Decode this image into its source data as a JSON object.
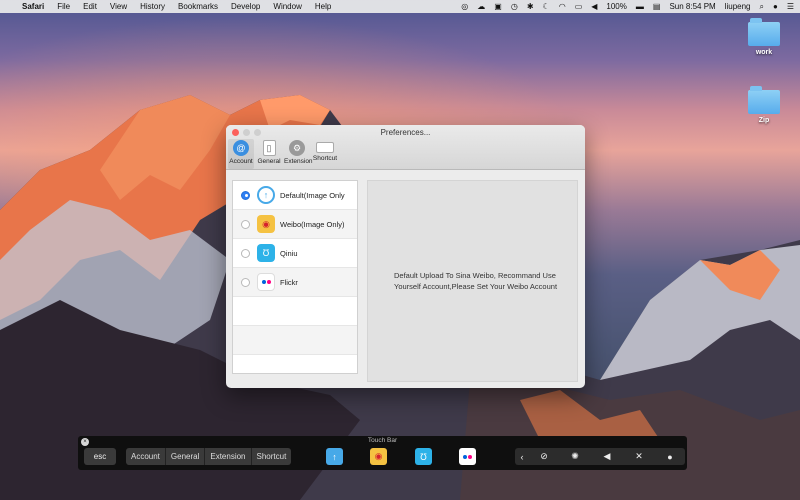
{
  "menubar": {
    "apple": "",
    "app": "Safari",
    "items": [
      "File",
      "Edit",
      "View",
      "History",
      "Bookmarks",
      "Develop",
      "Window",
      "Help"
    ],
    "battery": "100%",
    "clock": "Sun 8:54 PM",
    "user": "liupeng"
  },
  "desktop": {
    "icons": [
      {
        "label": "work"
      },
      {
        "label": "Zip"
      }
    ]
  },
  "window": {
    "title": "Preferences...",
    "tabs": [
      {
        "label": "Account",
        "icon": "at-icon",
        "active": true
      },
      {
        "label": "General",
        "icon": "phone-icon"
      },
      {
        "label": "Extension",
        "icon": "gear-icon"
      },
      {
        "label": "Shortcut",
        "icon": "keyboard-icon"
      }
    ],
    "services": [
      {
        "label": "Default(Image Only",
        "selected": true
      },
      {
        "label": "Weibo(Image Only)",
        "selected": false
      },
      {
        "label": "Qiniu",
        "selected": false
      },
      {
        "label": "Flickr",
        "selected": false
      }
    ],
    "detail_text": "Default Upload To Sina Weibo, Recommand Use Yourself Account,Please Set Your Weibo Account"
  },
  "touchbar": {
    "title": "Touch Bar",
    "esc": "esc",
    "segments": [
      "Account",
      "General",
      "Extension",
      "Shortcut"
    ]
  },
  "colors": {
    "close": "#fc605c",
    "accent": "#2d7ff3",
    "weibo": "#f5c242",
    "qiniu": "#2db2e8",
    "flickr_blue": "#0063dc",
    "flickr_pink": "#ff0084"
  }
}
